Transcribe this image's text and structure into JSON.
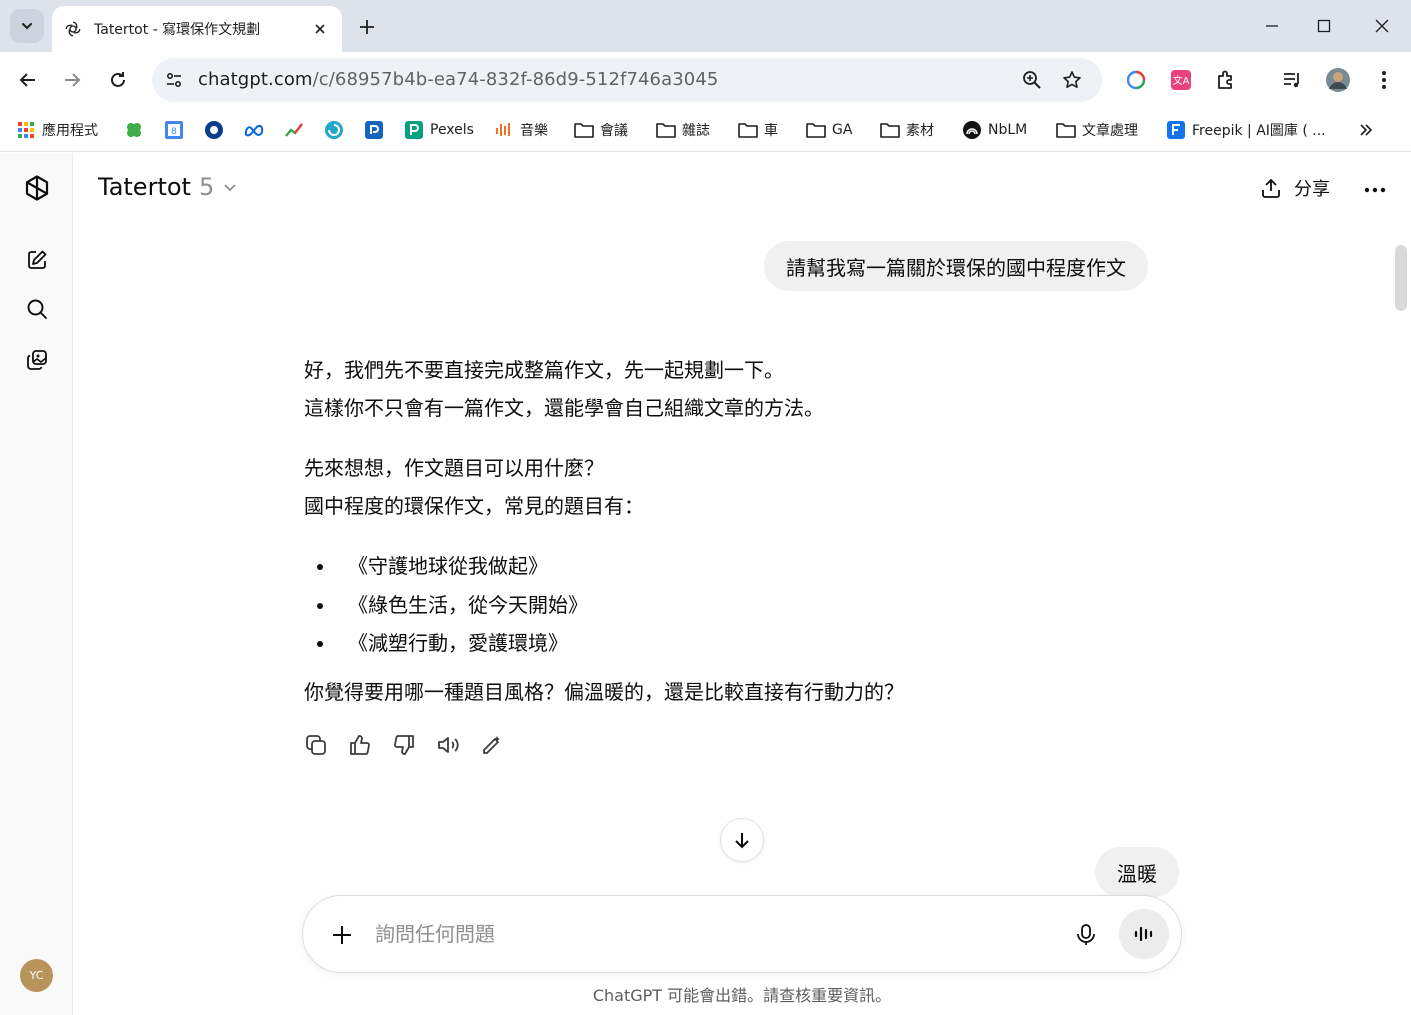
{
  "browser": {
    "tab_title": "Tatertot - 寫環保作文規劃",
    "url_host": "chatgpt.com",
    "url_path": "/c/68957b4b-ea74-832f-86d9-512f746a3045"
  },
  "bookmarks": [
    {
      "label": "應用程式",
      "icon": "apps-grid-icon"
    },
    {
      "label": "",
      "icon": "clover-icon"
    },
    {
      "label": "",
      "icon": "calendar-icon"
    },
    {
      "label": "",
      "icon": "circle-app-icon"
    },
    {
      "label": "",
      "icon": "meta-icon"
    },
    {
      "label": "",
      "icon": "analytics-icon"
    },
    {
      "label": "",
      "icon": "swirl-app-icon"
    },
    {
      "label": "",
      "icon": "blue-app-icon"
    },
    {
      "label": "Pexels",
      "icon": "pexels-icon"
    },
    {
      "label": "音樂",
      "icon": "music-icon"
    },
    {
      "label": "會議",
      "icon": "folder-icon"
    },
    {
      "label": "雜誌",
      "icon": "folder-icon"
    },
    {
      "label": "車",
      "icon": "folder-icon"
    },
    {
      "label": "GA",
      "icon": "folder-icon"
    },
    {
      "label": "素材",
      "icon": "folder-icon"
    },
    {
      "label": "NbLM",
      "icon": "notebooklm-icon"
    },
    {
      "label": "文章處理",
      "icon": "folder-icon"
    },
    {
      "label": "Freepik | AI圖庫 ( ...",
      "icon": "freepik-icon"
    }
  ],
  "sidebar": {
    "avatar_initials": "YC"
  },
  "header": {
    "model_name": "Tatertot",
    "model_version": "5",
    "share_label": "分享"
  },
  "conversation": {
    "user_message": "請幫我寫一篇關於環保的國中程度作文",
    "assistant": {
      "para1_line1": "好，我們先不要直接完成整篇作文，先一起規劃一下。",
      "para1_line2": "這樣你不只會有一篇作文，還能學會自己組織文章的方法。",
      "para2_line1": "先來想想，作文題目可以用什麼？",
      "para2_line2": "國中程度的環保作文，常見的題目有：",
      "titles": [
        "《守護地球從我做起》",
        "《綠色生活，從今天開始》",
        "《減塑行動，愛護環境》"
      ],
      "question": "你覺得要用哪一種題目風格？偏溫暖的，還是比較直接有行動力的？"
    },
    "pending_user_chip": "溫暖"
  },
  "composer": {
    "placeholder": "詢問任何問題",
    "disclaimer": "ChatGPT 可能會出錯。請查核重要資訊。"
  }
}
